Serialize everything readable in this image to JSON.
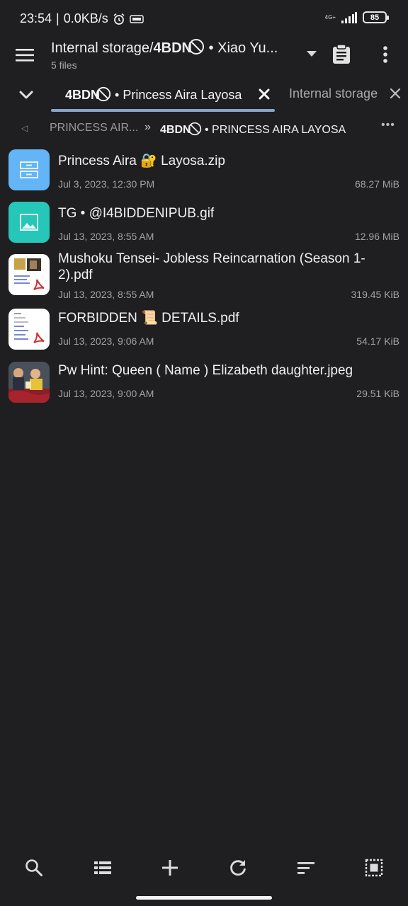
{
  "status_bar": {
    "time": "23:54",
    "net_speed": "0.0KB/s",
    "network_type": "4G+",
    "battery": "85",
    "icons": [
      "alarm-icon",
      "vpn-key-icon",
      "signal-icon",
      "battery-icon"
    ]
  },
  "toolbar": {
    "title_prefix": "Internal storage/",
    "title_bold": "4BDN",
    "title_suffix": " • Xiao Yu...",
    "subtitle": "5 files",
    "icons": [
      "menu-icon",
      "dropdown-arrow-icon",
      "clipboard-icon",
      "more-vert-icon"
    ]
  },
  "tabs": {
    "active_bold": "4BDN",
    "active_suffix": " • Princess Aira Layosa",
    "other_label": "Internal storage"
  },
  "breadcrumb": {
    "first": "PRINCESS AIR...",
    "separator": "»",
    "current_bold": "4BDN",
    "current_suffix": " • PRINCESS AIRA LAYOSA",
    "more": "•••"
  },
  "files": [
    {
      "name": "Princess Aira 🔐 Layosa.zip",
      "date": "Jul 3, 2023, 12:30 PM",
      "size": "68.27 MiB",
      "icon": "archive-icon"
    },
    {
      "name": "TG • @I4BIDDENIPUB.gif",
      "date": "Jul 13, 2023, 8:55 AM",
      "size": "12.96 MiB",
      "icon": "image-icon"
    },
    {
      "name": "Mushoku Tensei- Jobless Reincarnation (Season 1-2).pdf",
      "date": "Jul 13, 2023, 8:55 AM",
      "size": "319.45 KiB",
      "icon": "pdf-thumbnail"
    },
    {
      "name": "FORBIDDEN 📜 DETAILS.pdf",
      "date": "Jul 13, 2023, 9:06 AM",
      "size": "54.17 KiB",
      "icon": "pdf-thumbnail"
    },
    {
      "name": "Pw Hint: Queen ( Name ) Elizabeth daughter.jpeg",
      "date": "Jul 13, 2023, 9:00 AM",
      "size": "29.51 KiB",
      "icon": "photo-thumbnail"
    }
  ],
  "bottom_bar": {
    "icons": [
      "search-icon",
      "view-list-icon",
      "add-icon",
      "refresh-icon",
      "sort-icon",
      "select-all-icon"
    ]
  },
  "colors": {
    "background": "#1f1f21",
    "tab_underline": "#8aa4c8",
    "zip_icon_bg": "#64b5f6",
    "image_icon_bg": "#26c6b8"
  }
}
